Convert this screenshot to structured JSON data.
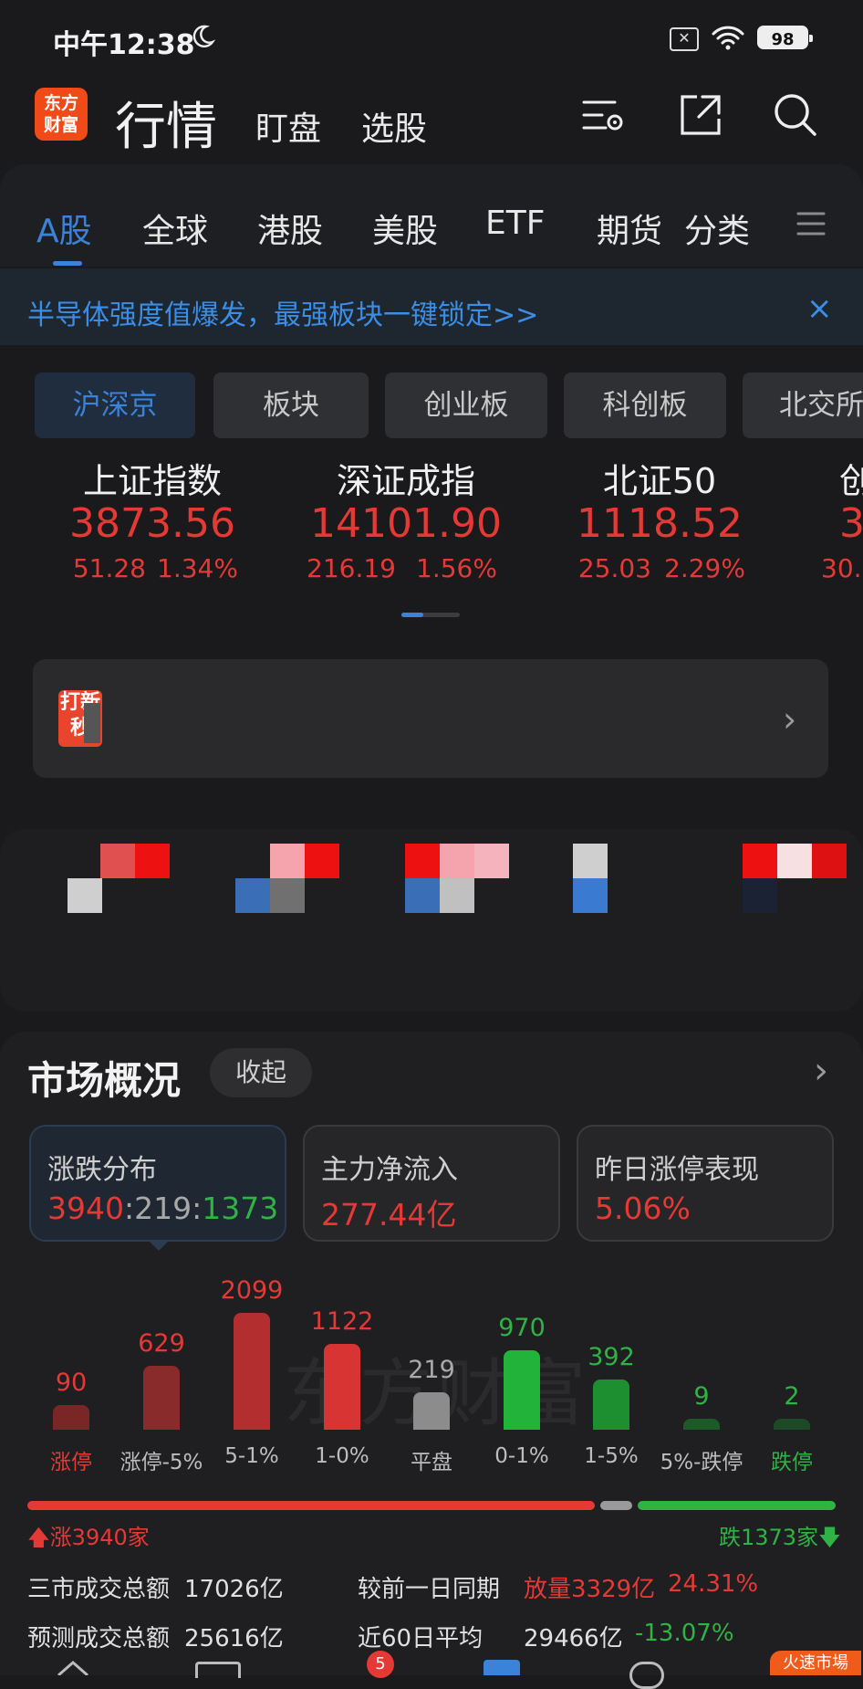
{
  "status": {
    "time": "中午12:38",
    "battery": "98",
    "sim_icon": "✕"
  },
  "header": {
    "logo_text": "东方\n财富",
    "title": "行情",
    "tabs": [
      "盯盘",
      "选股"
    ]
  },
  "market_tabs": [
    "A股",
    "全球",
    "港股",
    "美股",
    "ETF",
    "期货",
    "分类"
  ],
  "banner": {
    "text": "半导体强度值爆发，最强板块一键锁定>>",
    "close": "×"
  },
  "sub_tabs": [
    "沪深京",
    "板块",
    "创业板",
    "科创板",
    "北交所"
  ],
  "indices": [
    {
      "name": "上证指数",
      "value": "3873.56",
      "change": "51.28",
      "pct": "1.34%"
    },
    {
      "name": "深证成指",
      "value": "14101.90",
      "change": "216.19",
      "pct": "1.56%"
    },
    {
      "name": "北证50",
      "value": "1118.52",
      "change": "25.03",
      "pct": "2.29%"
    },
    {
      "name": "创",
      "value": "3",
      "change": "30.",
      "pct": ""
    }
  ],
  "promo": {
    "text": "打新\n秒"
  },
  "overview": {
    "title": "市场概况",
    "collapse_label": "收起",
    "cards": [
      {
        "label": "涨跌分布",
        "up": "3940",
        "flat": "219",
        "down": "1373"
      },
      {
        "label": "主力净流入",
        "value": "277.44亿"
      },
      {
        "label": "昨日涨停表现",
        "value": "5.06%"
      }
    ],
    "watermark": "东方财富"
  },
  "chart_data": {
    "type": "bar",
    "categories": [
      "涨停",
      "涨停-5%",
      "5-1%",
      "1-0%",
      "平盘",
      "0-1%",
      "1-5%",
      "5%-跌停",
      "跌停"
    ],
    "values": [
      90,
      629,
      2099,
      1122,
      219,
      970,
      392,
      9,
      2
    ],
    "colors": [
      "#7a2626",
      "#8a2b2b",
      "#b32e2e",
      "#d83434",
      "#8c8c8c",
      "#22b33a",
      "#1e8f31",
      "#1d5a2a",
      "#1d4a26"
    ],
    "label_colors": [
      "#e53935",
      "#e53935",
      "#e53935",
      "#e53935",
      "#aaaaaa",
      "#2fb344",
      "#2fb344",
      "#2fb344",
      "#2fb344"
    ],
    "ylim": [
      0,
      2099
    ]
  },
  "breadth": {
    "up_label": "涨3940家",
    "down_label": "跌1373家",
    "up": 3940,
    "flat": 219,
    "down": 1373
  },
  "stats": [
    {
      "label": "三市成交总额",
      "value": "17026亿",
      "label2": "较前一日同期",
      "value2": "放量3329亿",
      "pct": "24.31%"
    },
    {
      "label": "预测成交总额",
      "value": "25616亿",
      "label2": "近60日平均",
      "value2": "29466亿",
      "pct": "-13.07%"
    }
  ],
  "bottom_nav": {
    "badge": "5",
    "live": "火速市場"
  },
  "colors": {
    "up": "#e53935",
    "down": "#2fb344",
    "accent": "#3a83d8",
    "brand": "#f04a18"
  }
}
